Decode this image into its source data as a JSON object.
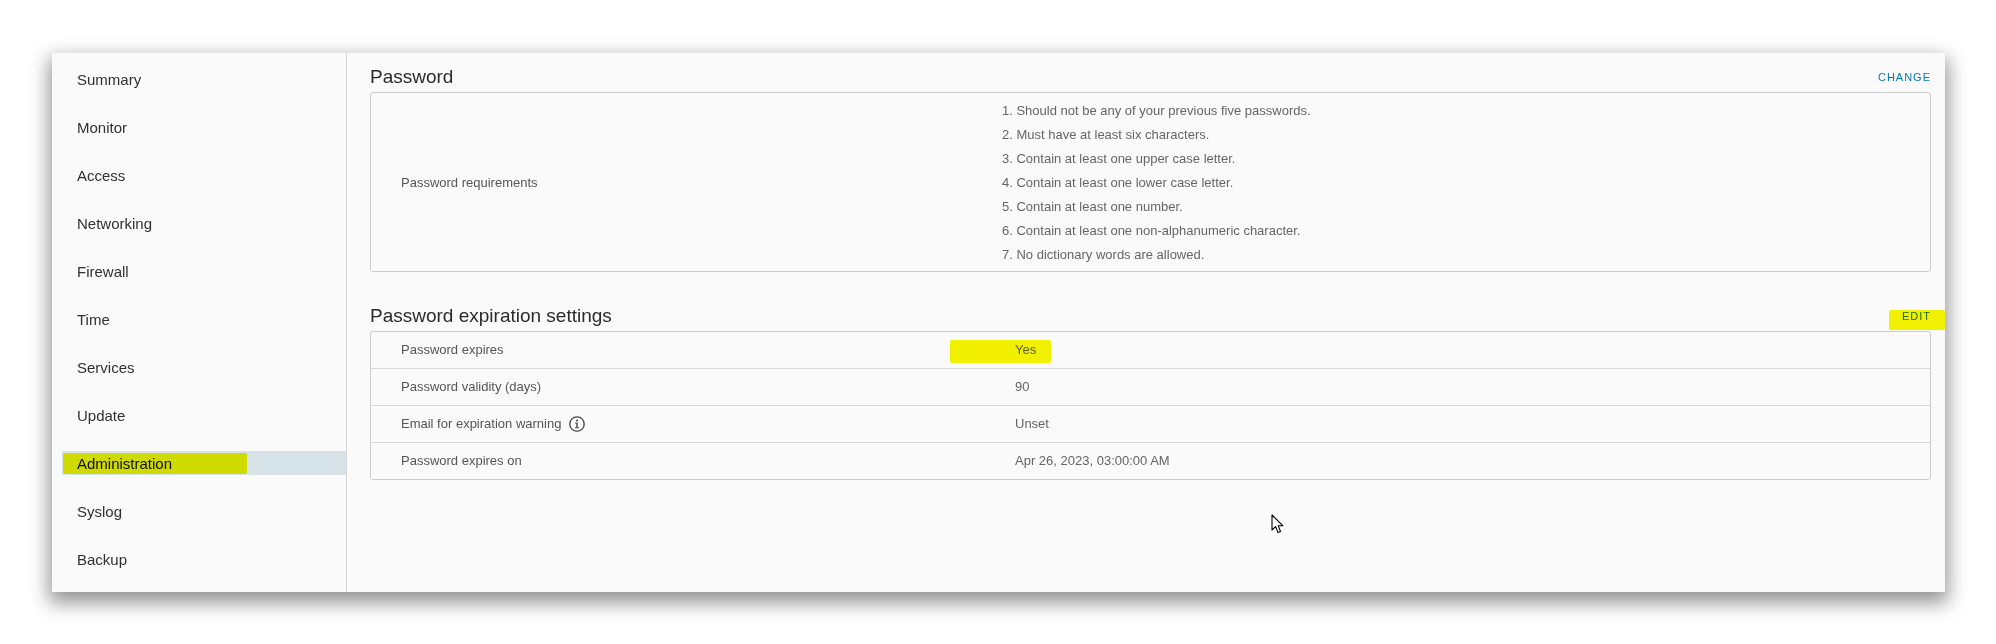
{
  "sidebar": {
    "items": [
      {
        "label": "Summary",
        "selected": false,
        "highlighted": false
      },
      {
        "label": "Monitor",
        "selected": false,
        "highlighted": false
      },
      {
        "label": "Access",
        "selected": false,
        "highlighted": false
      },
      {
        "label": "Networking",
        "selected": false,
        "highlighted": false
      },
      {
        "label": "Firewall",
        "selected": false,
        "highlighted": false
      },
      {
        "label": "Time",
        "selected": false,
        "highlighted": false
      },
      {
        "label": "Services",
        "selected": false,
        "highlighted": false
      },
      {
        "label": "Update",
        "selected": false,
        "highlighted": false
      },
      {
        "label": "Administration",
        "selected": true,
        "highlighted": true
      },
      {
        "label": "Syslog",
        "selected": false,
        "highlighted": false
      },
      {
        "label": "Backup",
        "selected": false,
        "highlighted": false
      }
    ]
  },
  "sections": [
    {
      "kind": "list",
      "title": "Password",
      "action": {
        "label": "CHANGE",
        "highlighted": false
      },
      "rows": [
        {
          "label": "Password requirements",
          "values": [
            "1. Should not be any of your previous five passwords.",
            "2. Must have at least six characters.",
            "3. Contain at least one upper case letter.",
            "4. Contain at least one lower case letter.",
            "5. Contain at least one number.",
            "6. Contain at least one non-alphanumeric character.",
            "7. No dictionary words are allowed."
          ]
        }
      ]
    },
    {
      "kind": "table",
      "title": "Password expiration settings",
      "action": {
        "label": "EDIT",
        "highlighted": true
      },
      "rows": [
        {
          "label": "Password expires",
          "value": "Yes",
          "info": false,
          "highlighted": true
        },
        {
          "label": "Password validity (days)",
          "value": "90",
          "info": false,
          "highlighted": false
        },
        {
          "label": "Email for expiration warning",
          "value": "Unset",
          "info": true,
          "highlighted": false
        },
        {
          "label": "Password expires on",
          "value": "Apr 26, 2023, 03:00:00 AM",
          "info": false,
          "highlighted": false
        }
      ]
    }
  ]
}
